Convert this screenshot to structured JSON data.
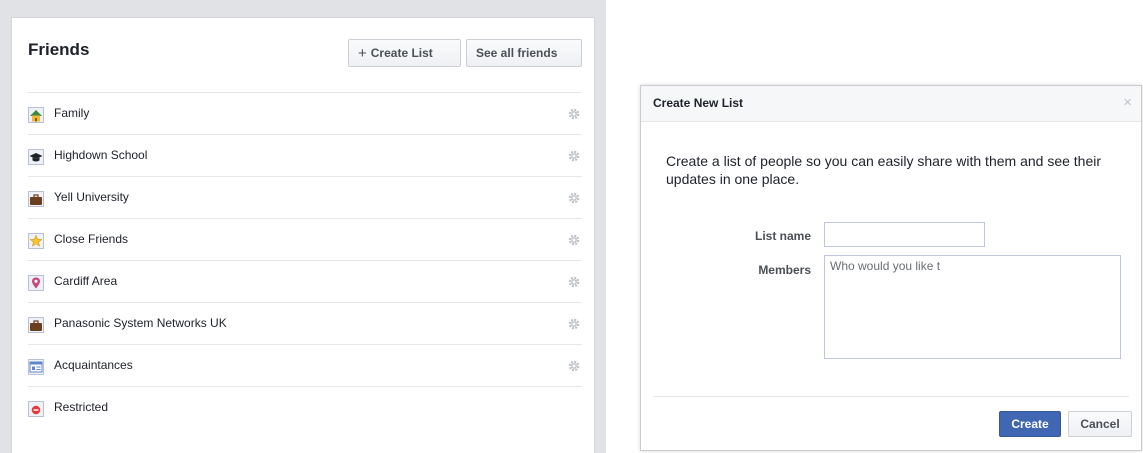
{
  "friends": {
    "title": "Friends",
    "create_list_label": "Create List",
    "see_all_label": "See all friends",
    "lists": [
      {
        "label": "Family",
        "icon": "house-icon"
      },
      {
        "label": "Highdown School",
        "icon": "graduation-cap-icon"
      },
      {
        "label": "Yell University",
        "icon": "briefcase-icon"
      },
      {
        "label": "Close Friends",
        "icon": "star-icon"
      },
      {
        "label": "Cardiff Area",
        "icon": "map-pin-icon"
      },
      {
        "label": "Panasonic System Networks UK",
        "icon": "briefcase-icon"
      },
      {
        "label": "Acquaintances",
        "icon": "acquaintances-icon"
      },
      {
        "label": "Restricted",
        "icon": "restricted-icon"
      }
    ]
  },
  "dialog": {
    "title": "Create New List",
    "close_glyph": "×",
    "description": "Create a list of people so you can easily share with them and see their updates in one place.",
    "list_name_label": "List name",
    "list_name_value": "",
    "members_label": "Members",
    "members_placeholder": "Who would you like t",
    "create_label": "Create",
    "cancel_label": "Cancel"
  },
  "colors": {
    "brand_blue": "#4267b2",
    "panel_background": "#e1e2e6",
    "text": "#1d2129"
  }
}
